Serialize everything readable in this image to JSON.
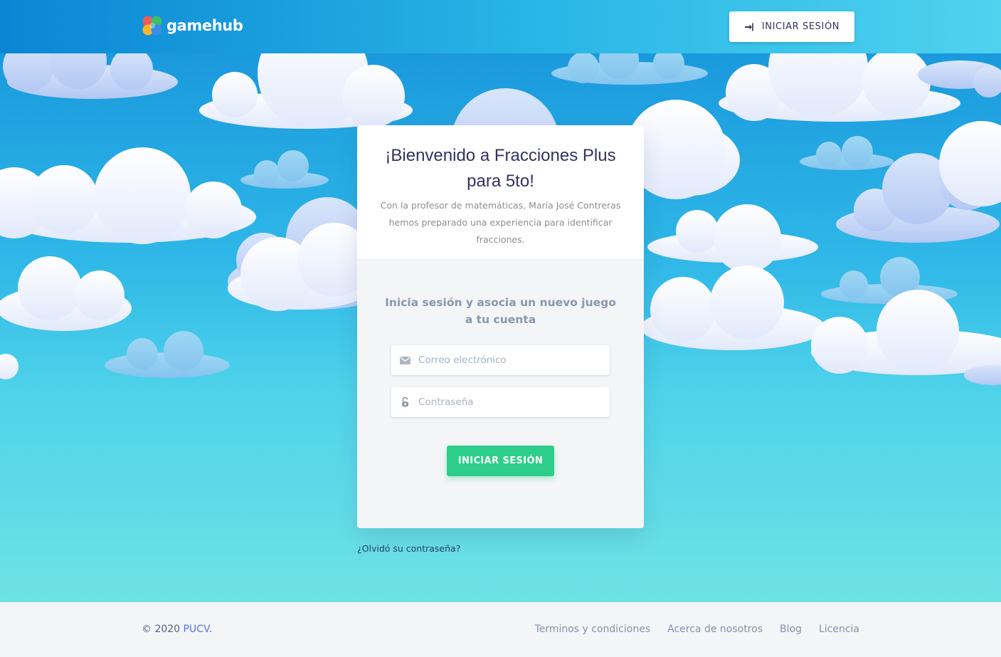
{
  "brand": {
    "name": "gamehub"
  },
  "header": {
    "login_label": "INICIAR SESIÓN",
    "login_icon": "sign-in-icon"
  },
  "welcome": {
    "title": "¡Bienvenido a Fracciones Plus para 5to!",
    "description": "Con la profesor de matemáticas, María José Contreras hemos preparado una experiencia para identificar fracciones."
  },
  "form": {
    "subtitle": "Inicia sesión y asocia un nuevo juego a tu cuenta",
    "email": {
      "placeholder": "Correo electrónico",
      "value": "",
      "icon": "envelope-icon"
    },
    "password": {
      "placeholder": "Contraseña",
      "value": "",
      "icon": "lock-open-icon"
    },
    "submit_label": "INICIAR SESIÓN"
  },
  "forgot_password": "¿Olvidó su contraseña?",
  "footer": {
    "copyright_prefix": "© 2020",
    "copyright_link": "PUCV",
    "copyright_suffix": ".",
    "links": [
      "Terminos y condiciones",
      "Acerca de nosotros",
      "Blog",
      "Licencia"
    ]
  },
  "colors": {
    "header_start": "#0a86d4",
    "header_end": "#4ed2ee",
    "accent_green": "#2dce89",
    "link_purple": "#5e72e4",
    "text_dark": "#32325d"
  }
}
